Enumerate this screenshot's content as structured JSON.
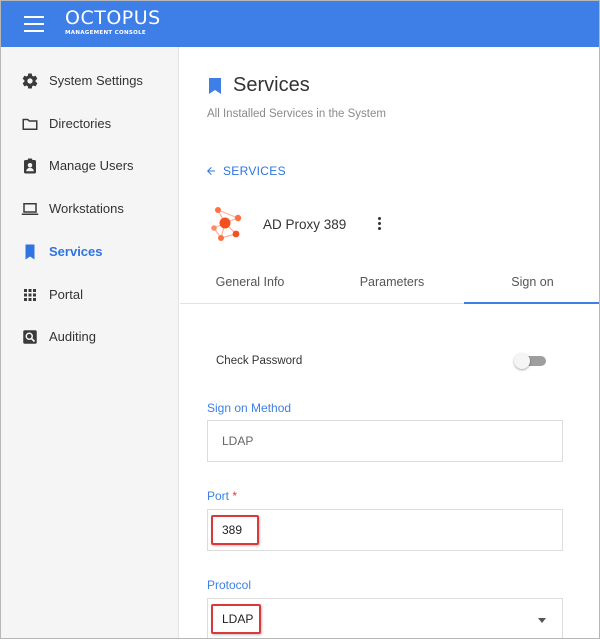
{
  "header": {
    "logo_main": "OCTOPUS",
    "logo_sub": "MANAGEMENT CONSOLE"
  },
  "sidebar": {
    "items": [
      {
        "label": "System Settings",
        "icon": "gear-icon",
        "active": false
      },
      {
        "label": "Directories",
        "icon": "folder-icon",
        "active": false
      },
      {
        "label": "Manage Users",
        "icon": "user-badge-icon",
        "active": false
      },
      {
        "label": "Workstations",
        "icon": "laptop-icon",
        "active": false
      },
      {
        "label": "Services",
        "icon": "bookmark-icon",
        "active": true
      },
      {
        "label": "Portal",
        "icon": "grid-icon",
        "active": false
      },
      {
        "label": "Auditing",
        "icon": "search-box-icon",
        "active": false
      }
    ]
  },
  "main": {
    "title": "Services",
    "subtitle": "All Installed Services in the System",
    "back_link": "SERVICES",
    "service_name": "AD Proxy 389",
    "tabs": [
      {
        "label": "General Info",
        "active": false
      },
      {
        "label": "Parameters",
        "active": false
      },
      {
        "label": "Sign on",
        "active": true
      }
    ],
    "check_password": {
      "label": "Check Password",
      "enabled": false
    },
    "sign_on_method": {
      "label": "Sign on Method",
      "value": "LDAP"
    },
    "port": {
      "label": "Port",
      "required_mark": "*",
      "value": "389"
    },
    "protocol": {
      "label": "Protocol",
      "value": "LDAP"
    }
  },
  "colors": {
    "header_bg": "#3d7fe6",
    "accent": "#2f74e0",
    "highlight_border": "#d9393b",
    "required": "#e53935"
  }
}
